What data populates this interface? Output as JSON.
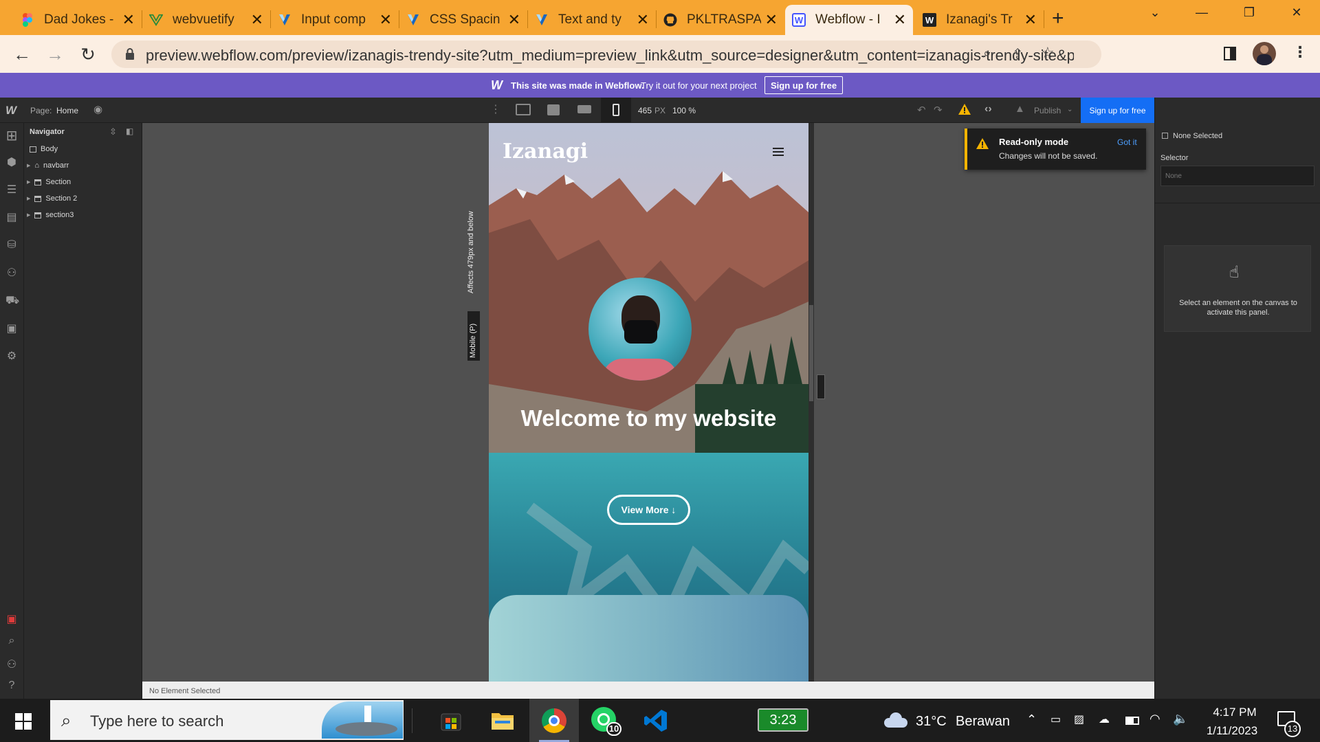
{
  "browser": {
    "tabs": [
      {
        "title": "Dad Jokes -",
        "icon": "figma-icon",
        "active": false
      },
      {
        "title": "webvuetify",
        "icon": "vuetify-icon",
        "active": false
      },
      {
        "title": "Input comp",
        "icon": "vuetify-icon",
        "active": false
      },
      {
        "title": "CSS Spacin",
        "icon": "vuetify-icon",
        "active": false
      },
      {
        "title": "Text and ty",
        "icon": "vuetify-icon",
        "active": false
      },
      {
        "title": "PKLTRASPA",
        "icon": "github-icon",
        "active": false
      },
      {
        "title": "Webflow - I",
        "icon": "webflow-icon",
        "active": true
      },
      {
        "title": "Izanagi's Tr",
        "icon": "webflow-icon",
        "active": false
      }
    ],
    "new_tab_label": "+",
    "url": "preview.webflow.com/preview/izanagis-trendy-site?utm_medium=preview_link&utm_source=designer&utm_content=izanagis-trendy-site&preview...",
    "accent": "#f6a531"
  },
  "banner": {
    "logo": "W",
    "made_in": "This site was made in Webflow.",
    "try_text": "Try it out for your next project",
    "cta": "Sign up for free"
  },
  "designer": {
    "page_label": "Page:",
    "page_name": "Home",
    "width_px": "465",
    "width_unit": "PX",
    "zoom": "100 %",
    "publish": "Publish",
    "signup": "Sign up for free",
    "breakpoint_tag": "Mobile (P)",
    "breakpoint_note": "Affects 479px and below",
    "status": "No Element Selected"
  },
  "navigator": {
    "title": "Navigator",
    "items": [
      {
        "label": "Body",
        "depth": 0,
        "icon": "box-icon"
      },
      {
        "label": "navbarr",
        "depth": 1,
        "icon": "home-icon"
      },
      {
        "label": "Section",
        "depth": 1,
        "icon": "section-icon"
      },
      {
        "label": "Section 2",
        "depth": 1,
        "icon": "section-icon"
      },
      {
        "label": "section3",
        "depth": 1,
        "icon": "section-icon"
      }
    ]
  },
  "toast": {
    "title": "Read-only mode",
    "body": "Changes will not be saved.",
    "action": "Got it"
  },
  "style_panel": {
    "none_selected": "None Selected",
    "selector_label": "Selector",
    "selector_placeholder": "None",
    "empty_hint": "Select an element on the canvas to activate this panel."
  },
  "site": {
    "brand": "Izanagi",
    "headline": "Welcome to my website",
    "button": "View More ↓"
  },
  "taskbar": {
    "search_placeholder": "Type here to search",
    "whatsapp_badge": "10",
    "battery_widget": "3:23",
    "weather_temp": "31°C",
    "weather_text": "Berawan",
    "time": "4:17 PM",
    "date": "1/11/2023",
    "notif_count": "13"
  }
}
